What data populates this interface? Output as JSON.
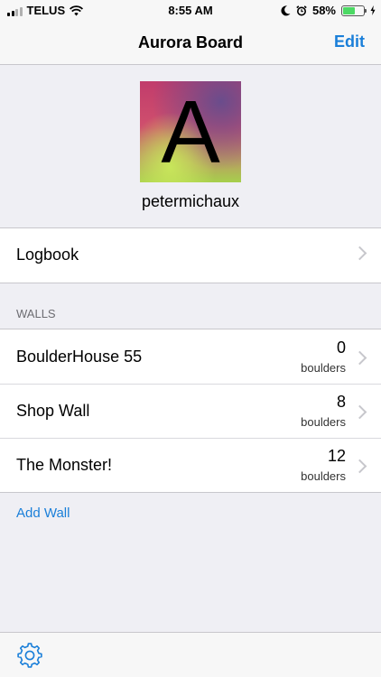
{
  "status_bar": {
    "carrier": "TELUS",
    "time": "8:55 AM",
    "battery_percent": "58%",
    "battery_level": 0.58
  },
  "nav": {
    "title": "Aurora Board",
    "edit_label": "Edit"
  },
  "profile": {
    "avatar_letter": "A",
    "username": "petermichaux"
  },
  "logbook": {
    "label": "Logbook"
  },
  "walls": {
    "section_title": "WALLS",
    "items": [
      {
        "name": "BoulderHouse 55",
        "count": "0",
        "unit": "boulders"
      },
      {
        "name": "Shop Wall",
        "count": "8",
        "unit": "boulders"
      },
      {
        "name": "The Monster!",
        "count": "12",
        "unit": "boulders"
      }
    ],
    "add_label": "Add Wall"
  },
  "toolbar": {
    "settings_icon": "gear-icon"
  },
  "colors": {
    "accent": "#1a7fd9",
    "battery": "#4cd964"
  }
}
